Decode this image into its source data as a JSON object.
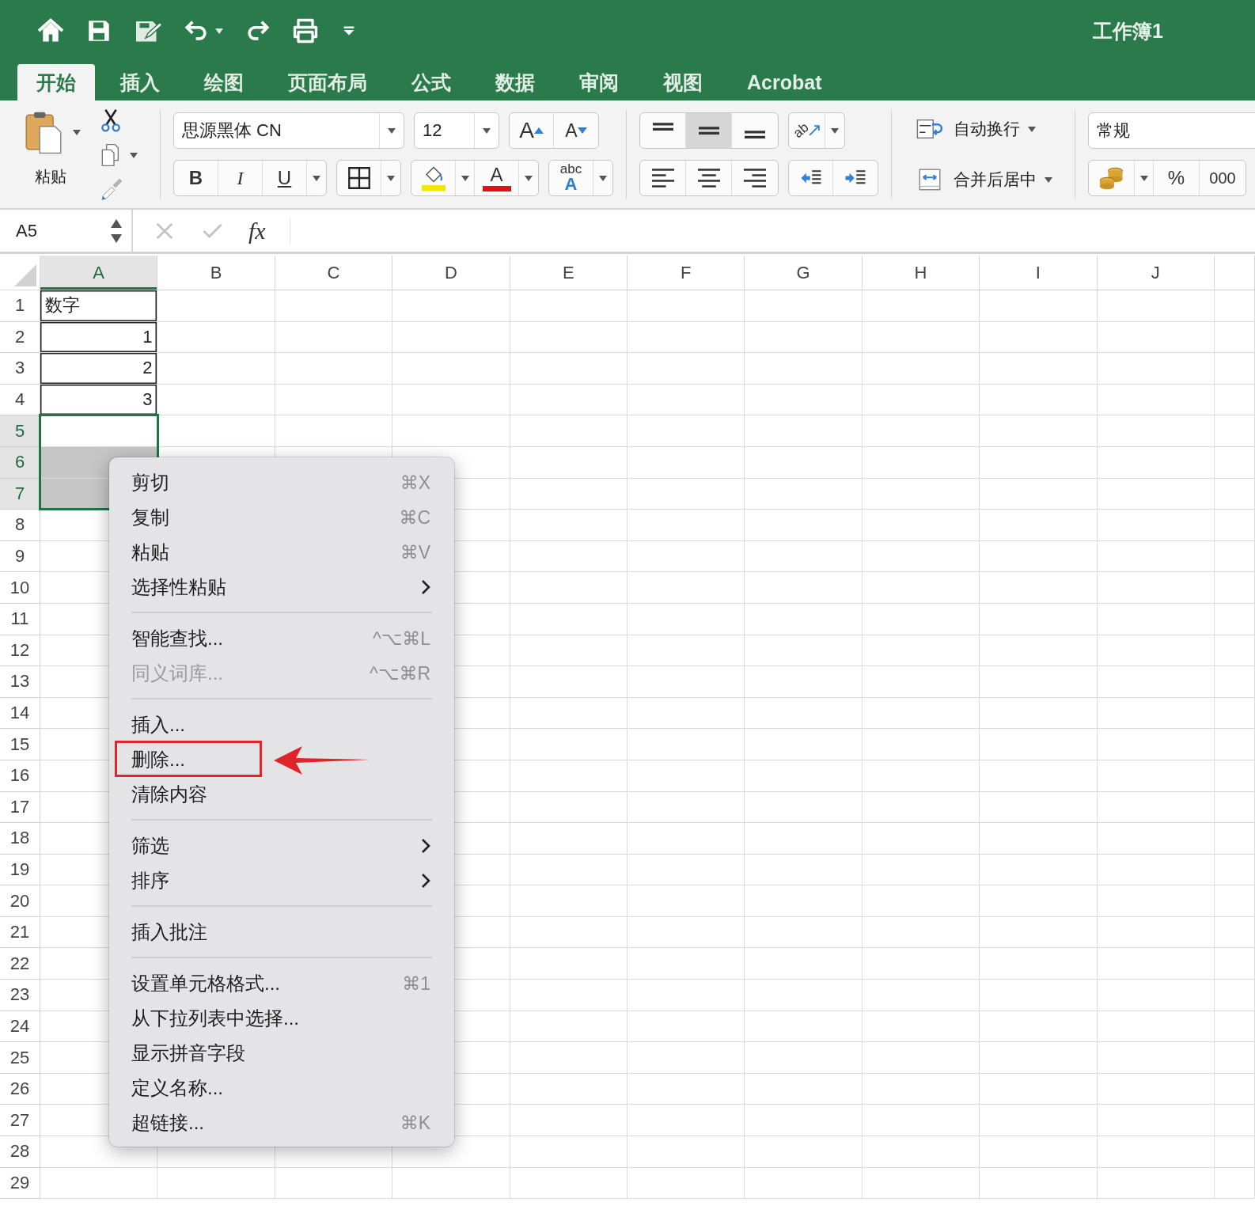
{
  "title_bar": {
    "title": "工作簿1"
  },
  "tabs": [
    {
      "label": "开始",
      "selected": true
    },
    {
      "label": "插入",
      "selected": false
    },
    {
      "label": "绘图",
      "selected": false
    },
    {
      "label": "页面布局",
      "selected": false
    },
    {
      "label": "公式",
      "selected": false
    },
    {
      "label": "数据",
      "selected": false
    },
    {
      "label": "审阅",
      "selected": false
    },
    {
      "label": "视图",
      "selected": false
    },
    {
      "label": "Acrobat",
      "selected": false
    }
  ],
  "ribbon": {
    "paste_label": "粘贴",
    "font_name": "思源黑体 CN",
    "font_size": "12",
    "grow_font": "A",
    "shrink_font": "A",
    "bold": "B",
    "italic": "I",
    "underline": "U",
    "font_color": "A",
    "phonetic_top": "abc",
    "phonetic_bottom": "A",
    "vertical_align": [
      {
        "kind": "top",
        "selected": false
      },
      {
        "kind": "middle",
        "selected": true
      },
      {
        "kind": "bottom",
        "selected": false
      }
    ],
    "horizontal_align": [
      {
        "kind": "left",
        "selected": false
      },
      {
        "kind": "center",
        "selected": false
      },
      {
        "kind": "right",
        "selected": false
      }
    ],
    "orientation_label": "ab",
    "wrap_text": "自动换行",
    "merge_center": "合并后居中",
    "number_format": "常规",
    "percent": "%",
    "thousands": "000"
  },
  "formula_bar": {
    "name_box": "A5",
    "function_label": "fx"
  },
  "sheet": {
    "columns": [
      {
        "label": "A",
        "selected": true
      },
      {
        "label": "B",
        "selected": false
      },
      {
        "label": "C",
        "selected": false
      },
      {
        "label": "D",
        "selected": false
      },
      {
        "label": "E",
        "selected": false
      },
      {
        "label": "F",
        "selected": false
      },
      {
        "label": "G",
        "selected": false
      },
      {
        "label": "H",
        "selected": false
      },
      {
        "label": "I",
        "selected": false
      },
      {
        "label": "J",
        "selected": false
      }
    ],
    "rows": [
      {
        "header": "1",
        "selected": false,
        "cells": [
          {
            "value": "数字",
            "kind": "text",
            "bordered": true
          }
        ]
      },
      {
        "header": "2",
        "selected": false,
        "cells": [
          {
            "value": "1",
            "kind": "number",
            "bordered": true
          }
        ]
      },
      {
        "header": "3",
        "selected": false,
        "cells": [
          {
            "value": "2",
            "kind": "number",
            "bordered": true
          }
        ]
      },
      {
        "header": "4",
        "selected": false,
        "cells": [
          {
            "value": "3",
            "kind": "number",
            "bordered": true
          }
        ]
      },
      {
        "header": "5",
        "selected": true
      },
      {
        "header": "6",
        "selected": true
      },
      {
        "header": "7",
        "selected": true
      },
      {
        "header": "8",
        "selected": false
      },
      {
        "header": "9",
        "selected": false
      },
      {
        "header": "10",
        "selected": false
      },
      {
        "header": "11",
        "selected": false
      },
      {
        "header": "12",
        "selected": false
      },
      {
        "header": "13",
        "selected": false
      },
      {
        "header": "14",
        "selected": false
      },
      {
        "header": "15",
        "selected": false
      },
      {
        "header": "16",
        "selected": false
      },
      {
        "header": "17",
        "selected": false
      },
      {
        "header": "18",
        "selected": false
      },
      {
        "header": "19",
        "selected": false
      },
      {
        "header": "20",
        "selected": false
      },
      {
        "header": "21",
        "selected": false
      },
      {
        "header": "22",
        "selected": false
      },
      {
        "header": "23",
        "selected": false
      },
      {
        "header": "24",
        "selected": false
      },
      {
        "header": "25",
        "selected": false
      },
      {
        "header": "26",
        "selected": false
      },
      {
        "header": "27",
        "selected": false
      },
      {
        "header": "28",
        "selected": false
      },
      {
        "header": "29",
        "selected": false
      }
    ]
  },
  "context_menu": {
    "groups": [
      {
        "items": [
          {
            "label": "剪切",
            "shortcut": "⌘X",
            "submenu": false,
            "disabled": false,
            "annotated": false
          },
          {
            "label": "复制",
            "shortcut": "⌘C",
            "submenu": false,
            "disabled": false,
            "annotated": false
          },
          {
            "label": "粘贴",
            "shortcut": "⌘V",
            "submenu": false,
            "disabled": false,
            "annotated": false
          },
          {
            "label": "选择性粘贴",
            "submenu": true,
            "disabled": false,
            "annotated": false
          }
        ]
      },
      {
        "items": [
          {
            "label": "智能查找...",
            "shortcut": "^⌥⌘L",
            "submenu": false,
            "disabled": false,
            "annotated": false
          },
          {
            "label": "同义词库...",
            "shortcut": "^⌥⌘R",
            "submenu": false,
            "disabled": true,
            "annotated": false
          }
        ]
      },
      {
        "items": [
          {
            "label": "插入...",
            "submenu": false,
            "disabled": false,
            "annotated": false
          },
          {
            "label": "删除...",
            "submenu": false,
            "disabled": false,
            "annotated": true
          },
          {
            "label": "清除内容",
            "submenu": false,
            "disabled": false,
            "annotated": false
          }
        ]
      },
      {
        "items": [
          {
            "label": "筛选",
            "submenu": true,
            "disabled": false,
            "annotated": false
          },
          {
            "label": "排序",
            "submenu": true,
            "disabled": false,
            "annotated": false
          }
        ]
      },
      {
        "items": [
          {
            "label": "插入批注",
            "submenu": false,
            "disabled": false,
            "annotated": false
          }
        ]
      },
      {
        "items": [
          {
            "label": "设置单元格格式...",
            "shortcut": "⌘1",
            "submenu": false,
            "disabled": false,
            "annotated": false
          },
          {
            "label": "从下拉列表中选择...",
            "submenu": false,
            "disabled": false,
            "annotated": false
          },
          {
            "label": "显示拼音字段",
            "submenu": false,
            "disabled": false,
            "annotated": false
          },
          {
            "label": "定义名称...",
            "submenu": false,
            "disabled": false,
            "annotated": false
          },
          {
            "label": "超链接...",
            "shortcut": "⌘K",
            "submenu": false,
            "disabled": false,
            "annotated": false
          }
        ]
      }
    ]
  }
}
